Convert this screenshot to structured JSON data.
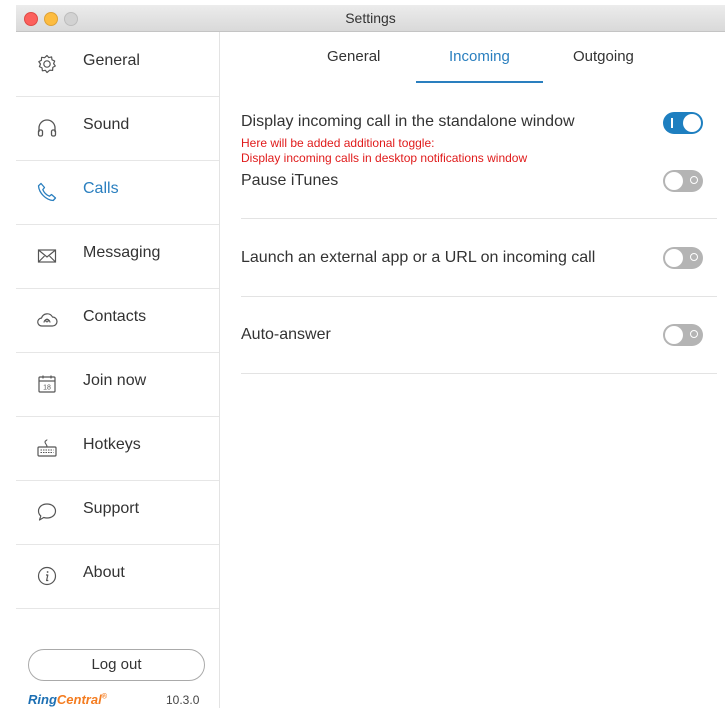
{
  "window": {
    "title": "Settings"
  },
  "sidebar": {
    "items": [
      {
        "label": "General",
        "icon": "gear-icon"
      },
      {
        "label": "Sound",
        "icon": "headphones-icon"
      },
      {
        "label": "Calls",
        "icon": "phone-icon",
        "active": true
      },
      {
        "label": "Messaging",
        "icon": "envelope-icon"
      },
      {
        "label": "Contacts",
        "icon": "cloud-contacts-icon"
      },
      {
        "label": "Join now",
        "icon": "calendar-icon"
      },
      {
        "label": "Hotkeys",
        "icon": "keyboard-icon"
      },
      {
        "label": "Support",
        "icon": "speech-bubble-icon"
      },
      {
        "label": "About",
        "icon": "info-icon"
      }
    ],
    "logout_label": "Log out",
    "brand_ring": "Ring",
    "brand_central": "Central",
    "brand_mark": "®",
    "version": "10.3.0"
  },
  "tabs": {
    "general": "General",
    "incoming": "Incoming",
    "outgoing": "Outgoing",
    "active": "Incoming"
  },
  "settings": {
    "display_incoming": {
      "label": "Display incoming call in the standalone window",
      "on": true
    },
    "note_line1": "Here will be added additional toggle:",
    "note_line2": "Display incoming calls in desktop notifications window",
    "pause_itunes": {
      "label": "Pause iTunes",
      "on": false
    },
    "launch_app": {
      "label": "Launch an external app or a URL on incoming call",
      "on": false
    },
    "auto_answer": {
      "label": "Auto-answer",
      "on": false
    }
  },
  "colors": {
    "accent": "#2a7fbf",
    "note": "#e01b1b",
    "toggle_off": "#b4b4b4",
    "toggle_on": "#1e7fc0"
  }
}
